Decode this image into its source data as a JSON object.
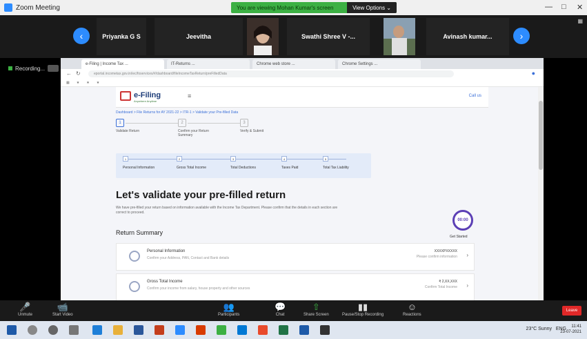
{
  "zoom_window": {
    "title": "Zoom Meeting",
    "share_banner_text": "You are viewing Mohan Kumar's screen",
    "view_options": "View Options ⌄"
  },
  "participants": [
    {
      "name": "Priyanka G S"
    },
    {
      "name": "Jeevitha"
    },
    {
      "name": ""
    },
    {
      "name": "Swathi Shree V -..."
    },
    {
      "name": ""
    },
    {
      "name": "Avinash kumar..."
    }
  ],
  "recording_label": "Recording...",
  "browser": {
    "tabs": [
      "e-Filing | Income Tax ...",
      "IT-Returns ...",
      "Chrome web store ...",
      "Chrome Settings ..."
    ],
    "url": "eportal.incometax.gov.in/iec/foservices/#/dashboard/fileIncomeTaxReturn/preFilledData"
  },
  "page": {
    "logo": "e-Filing",
    "logo_sub": "Anywhere Anytime",
    "header_right": "Call us",
    "breadcrumb": "Dashboard > File Returns for AY 2021-22 > ITR-1 > Validate your Pre-filled Data",
    "steps": [
      {
        "num": "1",
        "label": "Validate Return"
      },
      {
        "num": "2",
        "label": "Confirm your Return Summary"
      },
      {
        "num": "3",
        "label": "Verify & Submit"
      }
    ],
    "substeps": [
      {
        "num": "1",
        "label": "Personal Information"
      },
      {
        "num": "2",
        "label": "Gross Total Income"
      },
      {
        "num": "3",
        "label": "Total Deductions"
      },
      {
        "num": "4",
        "label": "Taxes Paid"
      },
      {
        "num": "5",
        "label": "Total Tax Liability"
      }
    ],
    "heading": "Let's validate your pre-filled return",
    "description": "We have pre-filled your return based on information available with the Income Tax Department. Please confirm that the details in each section are correct to proceed.",
    "return_summary": "Return Summary",
    "clock_text": "00:00",
    "get_started": "Get Started",
    "cards": [
      {
        "title": "Personal Information",
        "sub": "Confirm your Address, PAN, Contact and Bank details",
        "r1": "XXXXPXXXXX",
        "r2": "Please confirm information"
      },
      {
        "title": "Gross Total Income",
        "sub": "Confirm your income from salary, house property and other sources",
        "r1": "₹ 2,XX,XXX",
        "r2": "Confirm Total Income"
      }
    ]
  },
  "controls": [
    {
      "label": "Unmute",
      "glyph": "🎤"
    },
    {
      "label": "Start Video",
      "glyph": "📹"
    },
    {
      "label": "Participants",
      "glyph": "👥"
    },
    {
      "label": "Chat",
      "glyph": "💬"
    },
    {
      "label": "Share Screen",
      "glyph": "⇧"
    },
    {
      "label": "Pause/Stop Recording",
      "glyph": "▮▮"
    },
    {
      "label": "Reactions",
      "glyph": "☺"
    }
  ],
  "leave_label": "Leave",
  "taskbar": {
    "weather": "23°C Sunny",
    "lang": "ENG",
    "time": "11:41",
    "date": "23-07-2021"
  }
}
